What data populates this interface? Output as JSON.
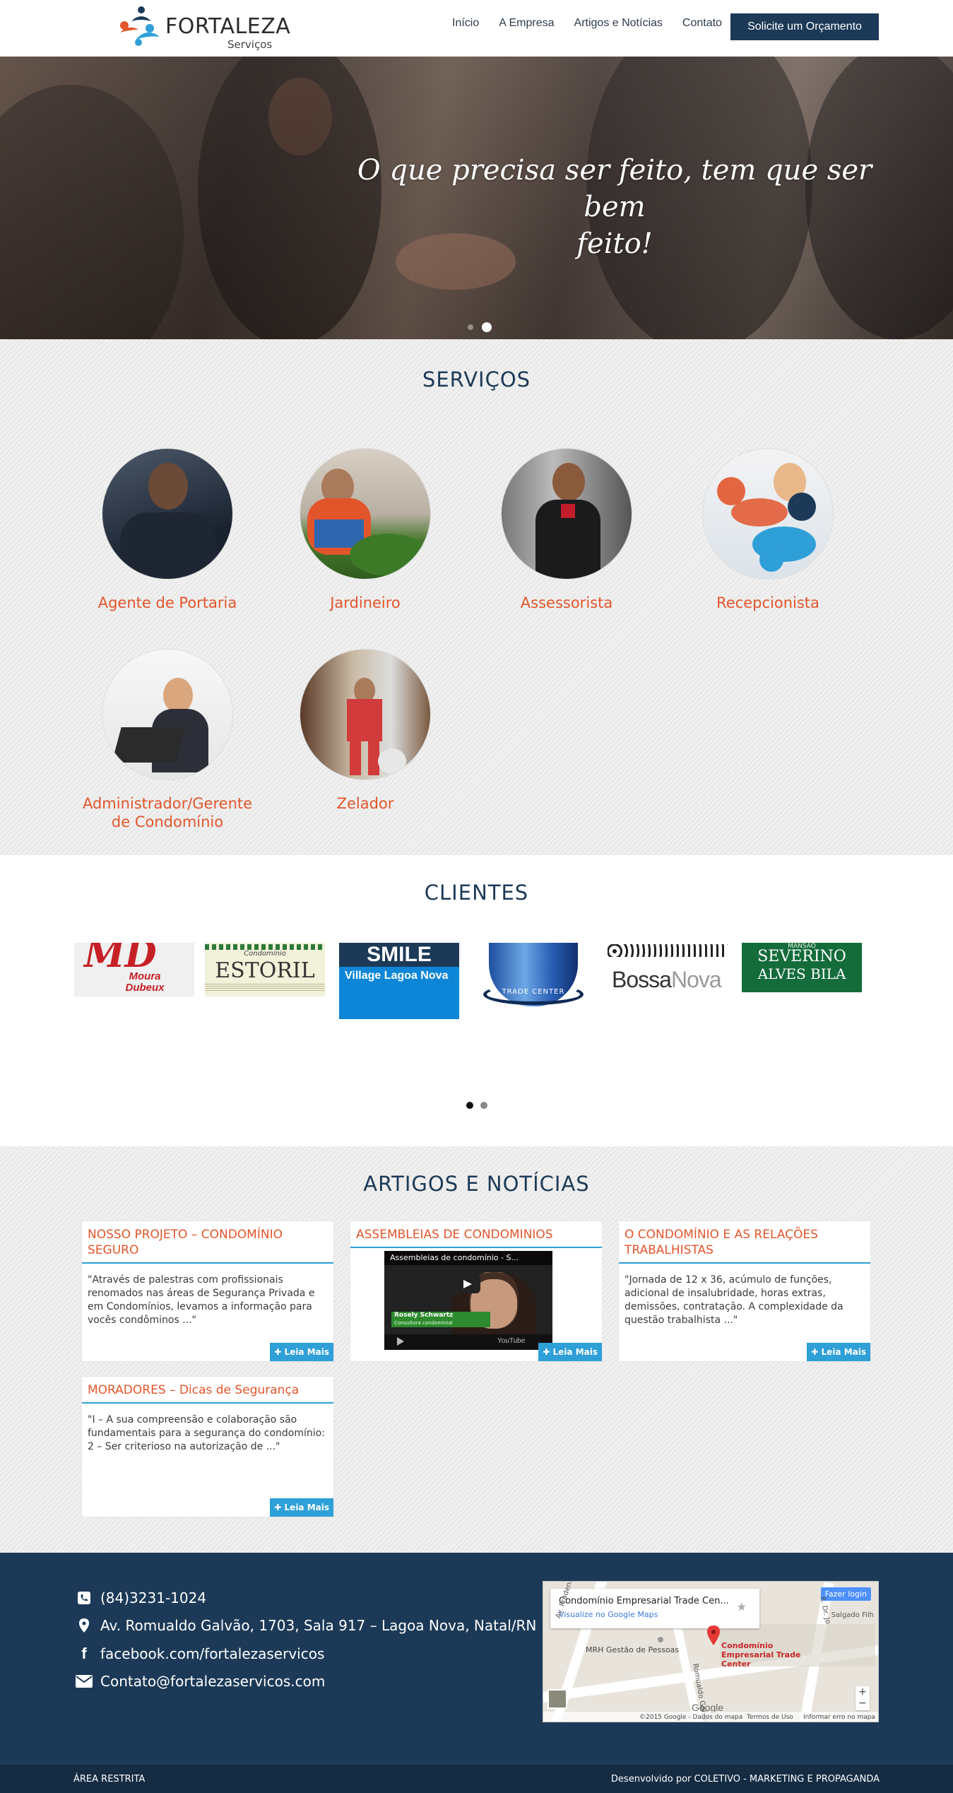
{
  "header": {
    "logo_name": "FORTALEZA",
    "logo_sub": "Serviços",
    "nav": [
      "Início",
      "A Empresa",
      "Artigos e Notícias",
      "Contato"
    ],
    "cta": "Solicite um Orçamento"
  },
  "hero": {
    "text": "O que precisa ser feito, tem que ser bem\nfeito!"
  },
  "servicos": {
    "title": "SERVIÇOS",
    "items": [
      "Agente de Portaria",
      "Jardineiro",
      "Assessorista",
      "Recepcionista",
      "Administrador/Gerente de Condomínio",
      "Zelador"
    ]
  },
  "clientes": {
    "title": "CLIENTES",
    "logos": {
      "moura_top": "MD",
      "moura_bottom": "Moura Dubeux",
      "estoril_small": "Condomínio",
      "estoril": "ESTORIL",
      "smile": "SMILE",
      "smile_sub": "Village Lagoa Nova",
      "trade": "TRADE CENTER",
      "bossa_a": "Bossa",
      "bossa_b": "Nova",
      "severino_small": "MANSÃO",
      "severino_a": "SEVERINO",
      "severino_b": "ALVES BILA"
    }
  },
  "artigos": {
    "title": "ARTIGOS E NOTÍCIAS",
    "read_more": "Leia Mais",
    "cards": [
      {
        "title": "NOSSO PROJETO – CONDOMÍNIO SEGURO",
        "excerpt": "\"Através de palestras com profissionais renomados nas áreas de Segurança Privada e em Condomínios, levamos a informação para vocês condôminos ...\""
      },
      {
        "title": "ASSEMBLEIAS DE CONDOMINIOS",
        "video_title": "Assembleias de condomínio - S...",
        "video_name": "Rosely Schwartz",
        "video_role": "Consultora condominial",
        "video_brand": "YouTube"
      },
      {
        "title": "O CONDOMÍNIO E AS RELAÇÕES TRABALHISTAS",
        "excerpt": "\"Jornada de 12 x 36, acúmulo de funções, adicional de insalubridade, horas extras, demissões, contratação. A complexidade da questão trabalhista ...\""
      },
      {
        "title": "MORADORES – Dicas de Segurança",
        "excerpt": "\"I – A sua compreensão e colaboração são fundamentais para a segurança do condomínio: 2 – Ser criterioso na autorização de ...\""
      }
    ]
  },
  "footer": {
    "phone": "(84)3231-1024",
    "address": "Av. Romualdo Galvão, 1703, Sala 917 – Lagoa Nova, Natal/RN",
    "facebook": "facebook.com/fortalezaservicos",
    "email": "Contato@fortalezaservicos.com",
    "map": {
      "place": "Condomínio Empresarial Trade Cen...",
      "link": "Visualize no Google Maps",
      "login": "Fazer login",
      "pin_label": "Condomínio Empresarial Trade Center",
      "poi": "MRH Gestão de Pessoas",
      "street1": "Av. Prudente",
      "street2": "Salgado Filh",
      "street3": "Romualdo Galvão",
      "street4": "R. Dr. Jo",
      "attrib": "©2015 Google - Dados do mapa",
      "terms": "Termos de Uso",
      "report": "Informar erro no mapa",
      "google": "Google",
      "zoom_in": "+",
      "zoom_out": "−"
    },
    "restricted": "ÁREA RESTRITA",
    "credit": "Desenvolvido por COLETIVO - MARKETING E PROPAGANDA"
  },
  "colors": {
    "navy": "#1c3a57",
    "orange": "#e2552b",
    "blue": "#2f9fd8"
  }
}
